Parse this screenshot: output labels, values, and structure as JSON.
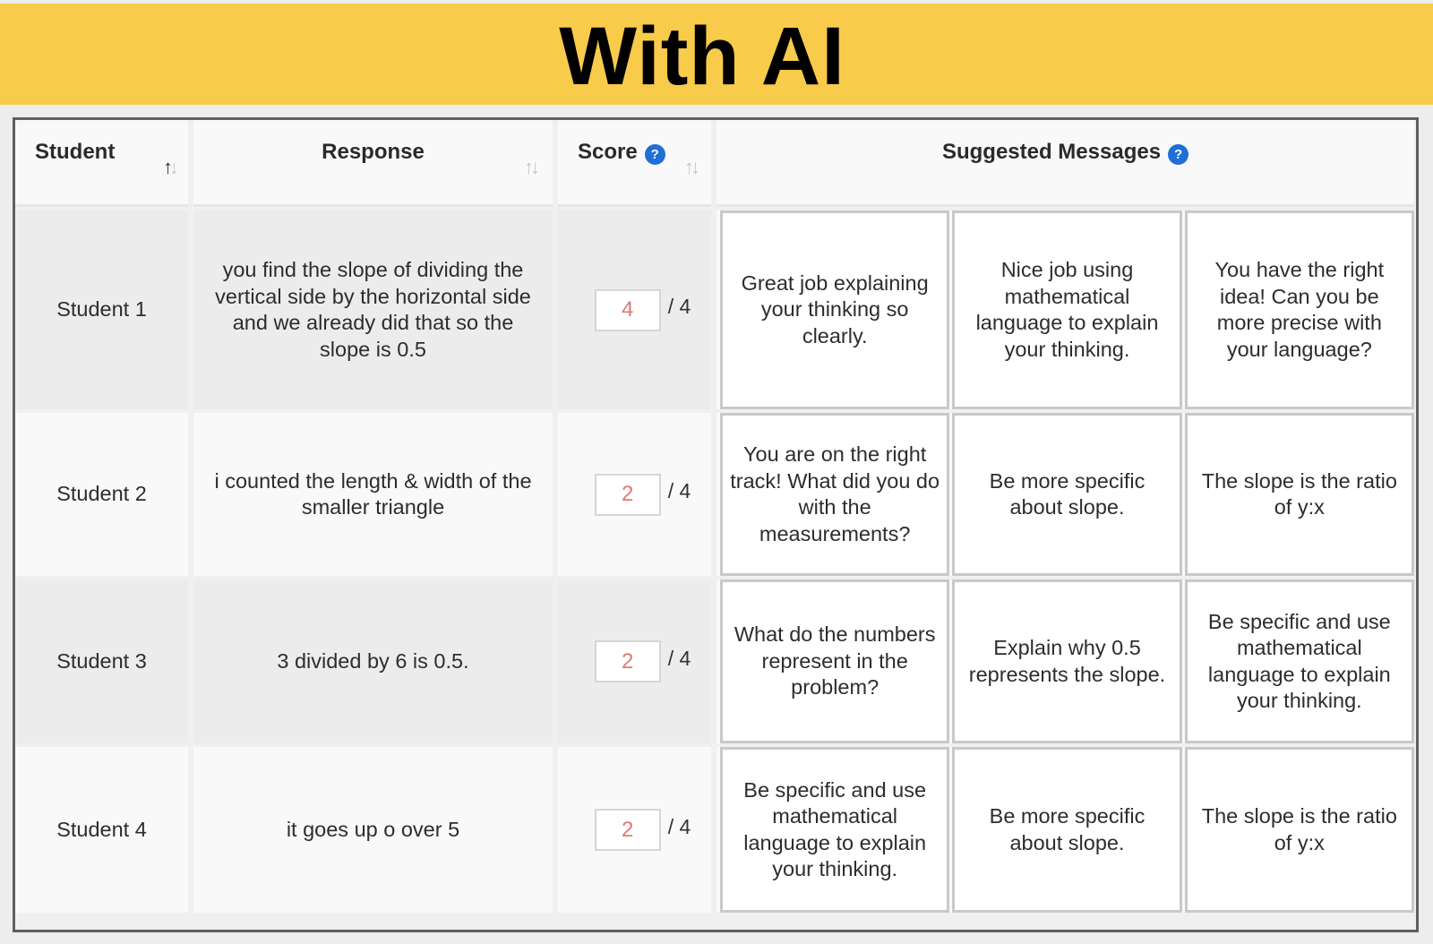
{
  "banner": {
    "title": "With AI"
  },
  "colors": {
    "banner_bg": "#f8cb4b",
    "help_icon": "#1f6fd6",
    "score_value": "#e07878"
  },
  "table": {
    "headers": {
      "student": "Student",
      "response": "Response",
      "score": "Score",
      "suggested": "Suggested Messages"
    },
    "help_icon_glyph": "?",
    "sort_icon_glyph_up": "↑",
    "sort_icon_glyph_down": "↓",
    "rows": [
      {
        "student": "Student 1",
        "response": "you find the slope of dividing the vertical side by the horizontal side and we already did that so the slope is 0.5",
        "score": "4",
        "score_max": "/ 4",
        "messages": [
          "Great job explaining your thinking so clearly.",
          "Nice job using mathematical language to explain your thinking.",
          "You have the right idea! Can you be more precise with your language?"
        ]
      },
      {
        "student": "Student 2",
        "response": "i counted the length & width of the smaller triangle",
        "score": "2",
        "score_max": "/ 4",
        "messages": [
          "You are on the right track! What did you do with the measurements?",
          "Be more specific about slope.",
          "The slope is the ratio of y:x"
        ]
      },
      {
        "student": "Student 3",
        "response": "3 divided by 6 is 0.5.",
        "score": "2",
        "score_max": "/ 4",
        "messages": [
          "What do the numbers represent in the problem?",
          "Explain why 0.5 represents the slope.",
          "Be specific and use mathematical language to explain your thinking."
        ]
      },
      {
        "student": "Student 4",
        "response": "it goes up o over 5",
        "score": "2",
        "score_max": "/ 4",
        "messages": [
          "Be specific and use mathematical language to explain your thinking.",
          "Be more specific about slope.",
          "The slope is the ratio of y:x"
        ]
      }
    ]
  }
}
